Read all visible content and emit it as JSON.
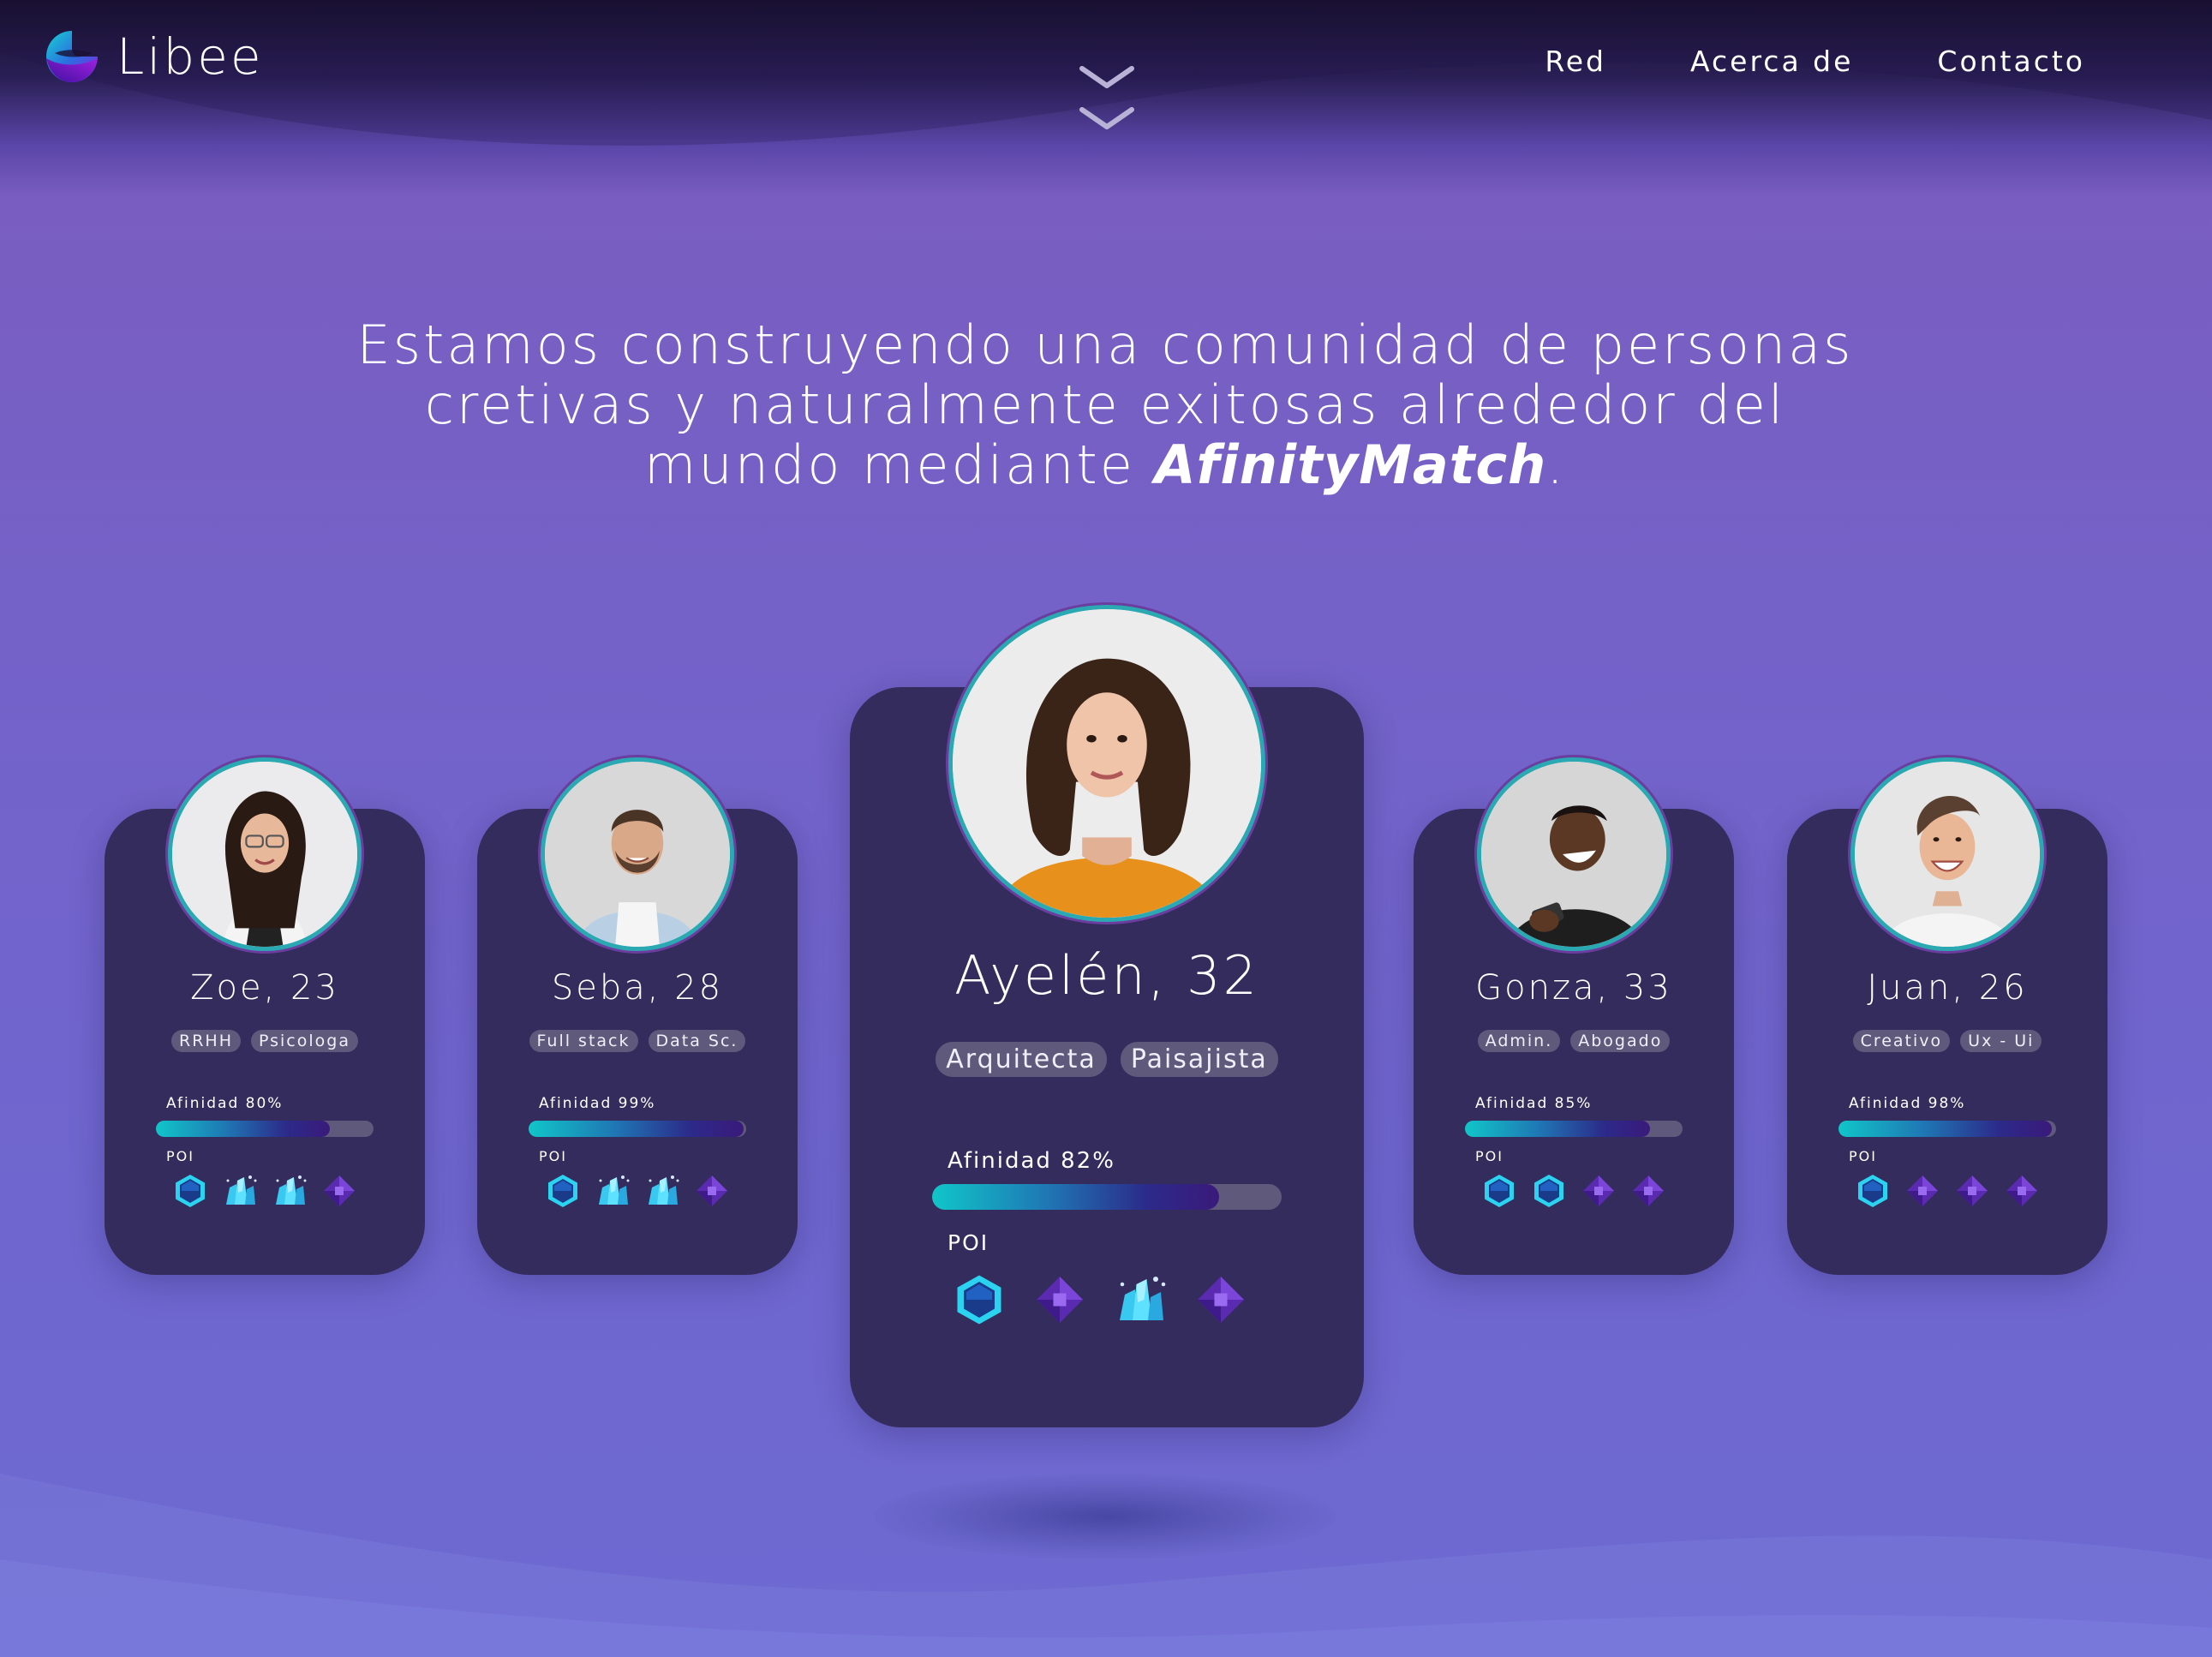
{
  "brand": {
    "name": "Libee"
  },
  "nav": {
    "items": [
      "Red",
      "Acerca de",
      "Contacto"
    ]
  },
  "hero": {
    "line1": "Estamos construyendo una comunidad de personas",
    "line2": "cretivas y naturalmente exitosas alrededor del",
    "line3_prefix": "mundo mediante ",
    "line3_brand": "AfinityMatch",
    "line3_suffix": "."
  },
  "profiles": [
    {
      "name": "Zoe, 23",
      "tags": [
        "RRHH",
        "Psicologa"
      ],
      "affinity_label": "Afinidad 80%",
      "affinity": 0.8,
      "poi_label": "POI",
      "poi": [
        "hexagon-gem-icon",
        "crystal-cluster-icon",
        "crystal-cluster-icon",
        "purple-diamond-icon"
      ]
    },
    {
      "name": "Seba, 28",
      "tags": [
        "Full stack",
        "Data Sc."
      ],
      "affinity_label": "Afinidad 99%",
      "affinity": 0.99,
      "poi_label": "POI",
      "poi": [
        "hexagon-gem-icon",
        "crystal-cluster-icon",
        "crystal-cluster-icon",
        "purple-diamond-icon"
      ]
    },
    {
      "name": "Ayelén, 32",
      "tags": [
        "Arquitecta",
        "Paisajista"
      ],
      "affinity_label": "Afinidad 82%",
      "affinity": 0.82,
      "poi_label": "POI",
      "poi": [
        "hexagon-gem-icon",
        "purple-diamond-icon",
        "crystal-cluster-icon",
        "purple-diamond-icon"
      ]
    },
    {
      "name": "Gonza, 33",
      "tags": [
        "Admin.",
        "Abogado"
      ],
      "affinity_label": "Afinidad 85%",
      "affinity": 0.85,
      "poi_label": "POI",
      "poi": [
        "hexagon-gem-icon",
        "hexagon-gem-icon",
        "purple-diamond-icon",
        "purple-diamond-icon"
      ]
    },
    {
      "name": "Juan, 26",
      "tags": [
        "Creativo",
        "Ux - Ui"
      ],
      "affinity_label": "Afinidad 98%",
      "affinity": 0.98,
      "poi_label": "POI",
      "poi": [
        "hexagon-gem-icon",
        "purple-diamond-icon",
        "purple-diamond-icon",
        "purple-diamond-icon"
      ]
    }
  ],
  "colors": {
    "card": "#332c5c",
    "accent_cyan": "#10c6c9",
    "accent_purple": "#7a5dc0",
    "tag": "#5f5a7c"
  }
}
